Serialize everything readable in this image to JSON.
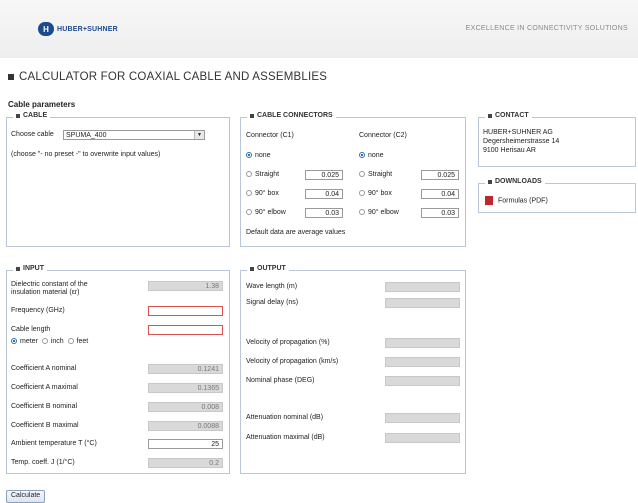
{
  "header": {
    "logo_mark": "H",
    "logo_text": "HUBER+SUHNER",
    "tagline": "EXCELLENCE IN CONNECTIVITY SOLUTIONS"
  },
  "page_title": "CALCULATOR FOR COAXIAL CABLE AND ASSEMBLIES",
  "section_heading": "Cable parameters",
  "cable": {
    "legend": "CABLE",
    "choose_label": "Choose cable",
    "selected": "SPUMA_400",
    "hint": "(choose \"- no preset -\" to overwrite input values)"
  },
  "connectors": {
    "legend": "CABLE CONNECTORS",
    "c1_header": "Connector (C1)",
    "c2_header": "Connector (C2)",
    "none": "none",
    "straight": "Straight",
    "box90": "90° box",
    "elbow90": "90° elbow",
    "c1_straight": "0.025",
    "c1_box": "0.04",
    "c1_elbow": "0.03",
    "c2_straight": "0.025",
    "c2_box": "0.04",
    "c2_elbow": "0.03",
    "note": "Default data are average values"
  },
  "contact": {
    "legend": "CONTACT",
    "line1": "HUBER+SUHNER AG",
    "line2": "Degersheimerstrasse 14",
    "line3": "9100 Herisau AR"
  },
  "downloads": {
    "legend": "DOWNLOADS",
    "formulas": "Formulas (PDF)"
  },
  "input": {
    "legend": "INPUT",
    "dielectric_label_1": "Dielectric constant of the",
    "dielectric_label_2": "insulation material (εr)",
    "dielectric_value": "1.38",
    "frequency_label": "Frequency (GHz)",
    "cable_length_label": "Cable length",
    "unit_meter": "meter",
    "unit_inch": "inch",
    "unit_feet": "feet",
    "coeff_a_nom_label": "Coefficient A nominal",
    "coeff_a_nom": "0.1241",
    "coeff_a_max_label": "Coefficient A maximal",
    "coeff_a_max": "0.1365",
    "coeff_b_nom_label": "Coefficient B nominal",
    "coeff_b_nom": "0.008",
    "coeff_b_max_label": "Coefficient B maximal",
    "coeff_b_max": "0.0088",
    "ambient_label": "Ambient temperature T (°C)",
    "ambient_value": "25",
    "temp_coeff_label": "Temp. coeff. J (1/°C)",
    "temp_coeff_value": "0.2"
  },
  "output": {
    "legend": "OUTPUT",
    "wave_length": "Wave length (m)",
    "signal_delay": "Signal delay (ns)",
    "vel_pct": "Velocity of propagation (%)",
    "vel_kms": "Velocity of propagation (km/s)",
    "nominal_phase": "Nominal phase (DEG)",
    "atten_nom": "Attenuation nominal (dB)",
    "atten_max": "Attenuation maximal (dB)"
  },
  "calculate_button": "Calculate"
}
